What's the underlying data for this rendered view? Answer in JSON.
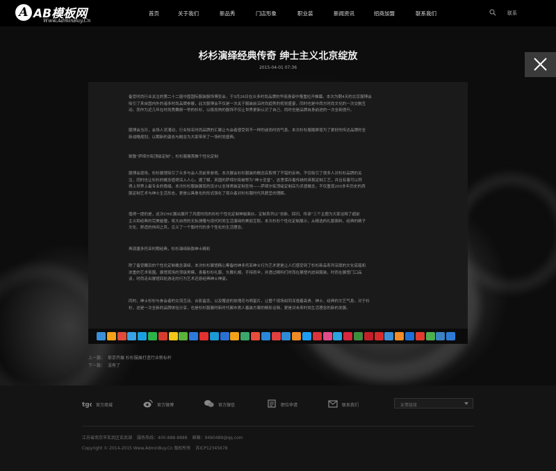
{
  "header": {
    "logo_mark": "A",
    "logo_text": "AB模板网",
    "logo_url": "Www.AdminBuy.Cn",
    "nav": [
      "首页",
      "关于我们",
      "新品秀",
      "门店形象",
      "职业装",
      "新闻资讯",
      "招商加盟",
      "联系我们"
    ],
    "lang": "联系"
  },
  "article": {
    "title": "杉杉演绎经典传奇 绅士主义北京绽放",
    "date": "2015-04-01 07:36",
    "paragraphs": [
      [
        "备受时尚行业关注的第二十二届中国国际服装服饰博览会，于3月26日在众多时尚品牌的华丽身姿中隆重拉开帷幕。本次为期4天的北京服博会",
        "吸引了来自国内外的诸多时尚品牌参展，此次服博会不仅是一次关于服装前沿时尚趋势的视觉盛宴，同时也是中西方时尚文化的一次交融互",
        "动。而作为近几年在时尚秀舞频一举的杉杉，以极尚熟的服饰不仅让世界更新认识了自己，同时也是品牌自身前进的一次全新提升。"
      ],
      [
        "服博会当日，会场人流涌动，行业知名时尚品牌的汇聚让与会者感受到不一样的迷尚时尚气息。本次杉杉服展屏增为了更好的传达品牌的全",
        "新战略规划，以期新的姿态与概念为大家带来了一场时尚盛典。"
      ],
      [
        "致敬“萨缔尔街顶级定制”，杉杉服展首推个性化定制"
      ],
      [
        "服博会现场，杉杉展馆吸引了众多与会人员前来参观。本次展会杉杉服装的概念店取得了不错的反响，不仅吸引了很多人对杉杉品牌的关",
        "注，同时也让杉杉的概念值得深入人心。据了解，英国的萨缔尔街被称为“绅士圣堂”，这里保存着传统的英裁定制工艺，并且有着可以称",
        "得上世界上最专业的裁缝。本次杉杉服装展现的设计以全球男装定制圣地——萨缔尔街顶级定制店为灵感概念，不仅重现200多年历史的西",
        "服定制艺术与绅士生活形态，更是以具象化的形式强化了观众者对杉杉服时代风貌呈的理解。"
      ],
      [
        "值得一提的是，这次CHIC展出展开了风度时尚的杉杉个性化定制神秘面纱。定制系列以“创新、回归、传承”三个主题为大家诠释了超前",
        "主义和经典的完美碰撞，将大自然的无私馈赠与现代时尚生活演绎的美丽互取。本次杉杉个性化定制展示，从精选的礼服面料、经典的精子",
        "文化、舒适的休闲之风，见义了一个衡时代的多个性化的生活理念。"
      ],
      [
        "再现唐多托亚时期经典，杉杉演绎新款绅士精彩"
      ],
      [
        "除了备受瞩目的个性化定制概念演绎，本次杉杉展馆精心筹备的绅多托亚绅士行为艺术更是让人们感受到了杉杉新品系列深厚的文化底蕴和",
        "浓重的艺术氛围。展馆现场的顶级男模，身着杉杉礼服，头戴礼帽，手持雨伞，并透过精科们时而在展馆内进阅服装，时而在展馆门口品",
        "谈，时而走出展馆四处游走的行为艺术还原经典绅士神姿。"
      ],
      [
        "同时，绅士杉杉与参会者的交流互动、合影留念，以及赠送的玫瑰花与明星片，让整个现场如同浑逸着高贵、绅士、经典的文艺气息。对于杉",
        "杉，这是一次全新的品牌体验分享，也是杉杉服展时新时代都市男人着装方案的精彩诠释，更是对未来时尚生活理念的新的发展。"
      ]
    ]
  },
  "share_icons": [
    "share-icon-1",
    "share-icon-2",
    "share-icon-3",
    "share-icon-4",
    "share-icon-5",
    "share-icon-6",
    "share-icon-7",
    "share-icon-8",
    "share-icon-9",
    "share-icon-10",
    "share-icon-11",
    "share-icon-12",
    "share-icon-13",
    "share-icon-14",
    "share-icon-15",
    "share-icon-16",
    "share-icon-17",
    "share-icon-18",
    "share-icon-19",
    "share-icon-20",
    "share-icon-21",
    "share-icon-22",
    "share-icon-23",
    "share-icon-24",
    "share-icon-25",
    "share-icon-26",
    "share-icon-27",
    "share-icon-28",
    "share-icon-29",
    "share-icon-30",
    "share-icon-31",
    "share-icon-32",
    "share-icon-33",
    "share-icon-34",
    "share-icon-35"
  ],
  "share_colors": [
    "#3b8fd6",
    "#f2a21a",
    "#e04b3b",
    "#3aa3e3",
    "#1aa0e0",
    "#2bb34a",
    "#d63c2e",
    "#f5c518",
    "#5bb33a",
    "#2d7ad8",
    "#e2312f",
    "#1c9ad6",
    "#2b6fd0",
    "#f2a21a",
    "#3ba86b",
    "#e84c3d",
    "#2a87d9",
    "#e24040",
    "#2e8bd6",
    "#f08a24",
    "#1d9bf0",
    "#d9343c",
    "#e24a8c",
    "#2ba4df",
    "#d7263d",
    "#3c8e3f",
    "#c21f2b",
    "#d62b2b",
    "#3d8ed6",
    "#f28c28",
    "#1d6fd6",
    "#e03b2f",
    "#4caf50",
    "#3b82c4",
    "#2e7bd6"
  ],
  "prev_next": {
    "prev_label": "上一篇：",
    "prev_title": "依京齐展 杉杉服展打造行业新标杆",
    "next_label": "下一篇：",
    "next_title": "没有了"
  },
  "footer": {
    "items": [
      "官方商城",
      "官方微博",
      "官方微信",
      "职位申请",
      "联系我们"
    ],
    "select": "友情链接",
    "info_line1": [
      "江苏省南京市玄武区玄武湖",
      "服务热线：400-888-8888",
      "邮箱：9490489@qq.com"
    ],
    "info_line2": [
      "Copyright © 2014-2015 Www.AdminBuy.Cn 版权所有",
      "苏ICP12345678"
    ]
  }
}
